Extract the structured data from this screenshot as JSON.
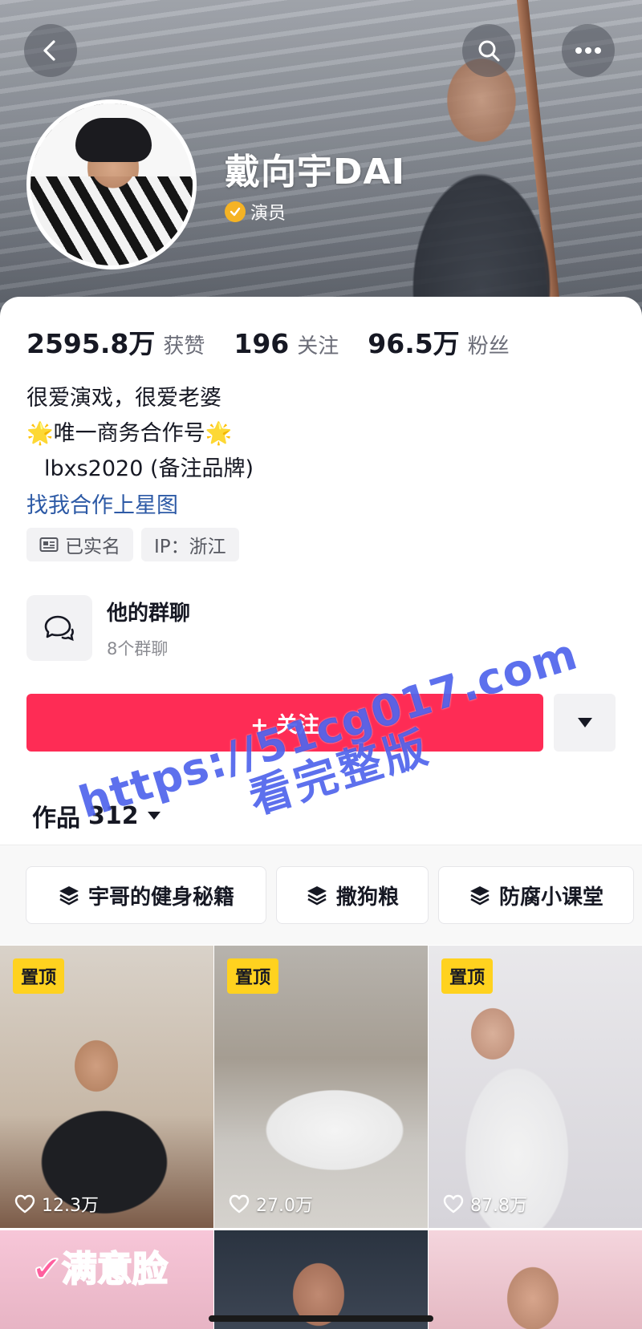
{
  "profile": {
    "name": "戴向宇DAI",
    "verification": "演员",
    "stats": [
      {
        "value": "2595.8万",
        "label": "获赞"
      },
      {
        "value": "196",
        "label": "关注"
      },
      {
        "value": "96.5万",
        "label": "粉丝"
      }
    ],
    "bio": {
      "line1": "很爱演戏，很爱老婆",
      "line2_star": "🌟",
      "line2_text": "唯一商务合作号",
      "line3": "lbxs2020 (备注品牌)"
    },
    "link": "找我合作上星图",
    "tags": [
      {
        "label": "已实名",
        "icon": "id-card-icon"
      },
      {
        "label": "IP：浙江"
      }
    ]
  },
  "group_chat": {
    "title": "他的群聊",
    "subtitle": "8个群聊"
  },
  "actions": {
    "follow_label": "+ 关注"
  },
  "works": {
    "label": "作品",
    "count": "312"
  },
  "collections": [
    {
      "label": "宇哥的健身秘籍"
    },
    {
      "label": "撒狗粮"
    },
    {
      "label": "防腐小课堂"
    }
  ],
  "videos": [
    {
      "pinned_label": "置顶",
      "likes": "12.3万"
    },
    {
      "pinned_label": "置顶",
      "likes": "27.0万"
    },
    {
      "pinned_label": "置顶",
      "likes": "87.8万"
    },
    {
      "cover_text": "✔满意脸"
    },
    {},
    {}
  ],
  "watermark": {
    "line1": "https://51cg017.com",
    "line2": "看完整版"
  },
  "colors": {
    "follow_button": "#fe2c55",
    "pin_badge": "#ffd21f",
    "link": "#2d5aa6",
    "verified_badge": "#f5b324",
    "watermark": "#3048e8"
  }
}
